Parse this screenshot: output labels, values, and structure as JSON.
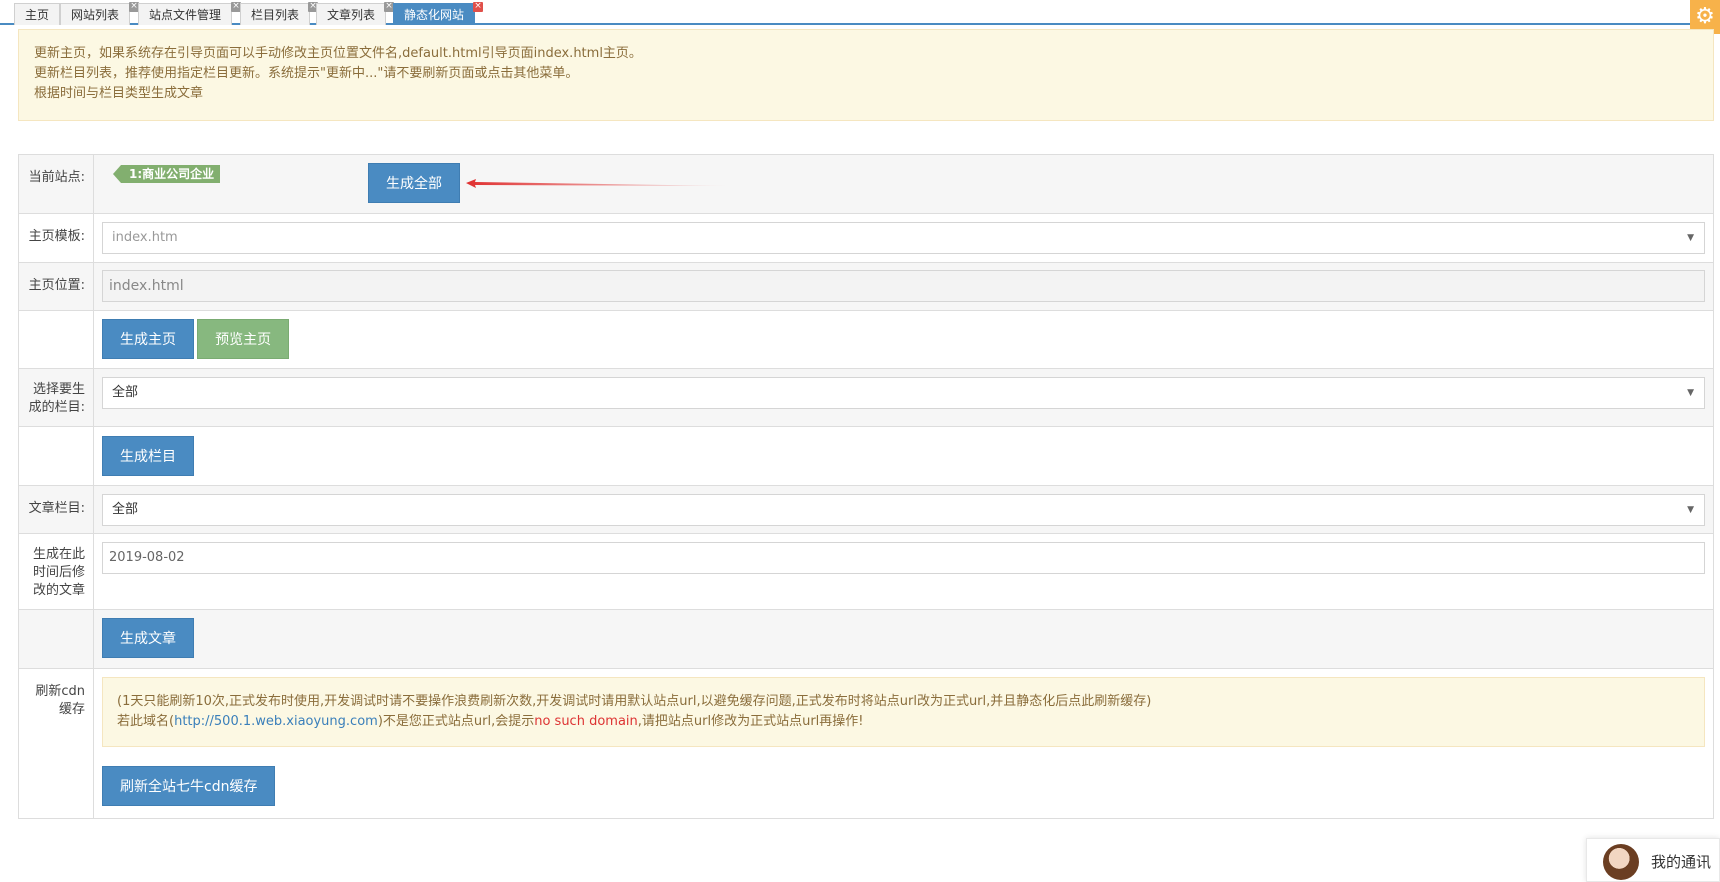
{
  "tabs": [
    {
      "label": "主页",
      "closable": false,
      "active": false
    },
    {
      "label": "网站列表",
      "closable": true,
      "active": false
    },
    {
      "label": "站点文件管理",
      "closable": true,
      "active": false
    },
    {
      "label": "栏目列表",
      "closable": true,
      "active": false
    },
    {
      "label": "文章列表",
      "closable": true,
      "active": false
    },
    {
      "label": "静态化网站",
      "closable": true,
      "active": true
    }
  ],
  "tab_close_glyph": "×",
  "settings_icon": "gear-icon",
  "notice": {
    "lines": [
      "更新主页，如果系统存在引导页面可以手动修改主页位置文件名,default.html引导页面index.html主页。",
      "更新栏目列表，推荐使用指定栏目更新。系统提示\"更新中...\"请不要刷新页面或点击其他菜单。",
      "根据时间与栏目类型生成文章"
    ]
  },
  "form": {
    "current_site": {
      "label": "当前站点:",
      "tag": "1:商业公司企业",
      "generate_all_label": "生成全部"
    },
    "home_template": {
      "label": "主页模板:",
      "value": "index.htm"
    },
    "home_location": {
      "label": "主页位置:",
      "value": "index.html"
    },
    "home_actions": {
      "generate_label": "生成主页",
      "preview_label": "预览主页"
    },
    "category_select": {
      "label": "选择要生成的栏目:",
      "value": "全部"
    },
    "category_actions": {
      "generate_label": "生成栏目"
    },
    "article_category": {
      "label": "文章栏目:",
      "value": "全部"
    },
    "modified_after": {
      "label": "生成在此时间后修改的文章",
      "value": "2019-08-02"
    },
    "article_actions": {
      "generate_label": "生成文章"
    },
    "cdn": {
      "label": "刷新cdn缓存",
      "note_line1": "(1天只能刷新10次,正式发布时使用,开发调试时请不要操作浪费刷新次数,开发调试时请用默认站点url,以避免缓存问题,正式发布时将站点url改为正式url,并且静态化后点此刷新缓存)",
      "note_prefix": "若此域名(",
      "domain": "http://500.1.web.xiaoyung.com",
      "note_middle": ")不是您正式站点url,会提示",
      "error_text": "no such domain",
      "note_suffix": ",请把站点url修改为正式站点url再操作!",
      "refresh_label": "刷新全站七牛cdn缓存"
    }
  },
  "chat_widget": {
    "label": "我的通讯"
  },
  "colors": {
    "primary": "#4a8bc2",
    "success": "#87b87f",
    "warning_bg": "#fcf8e3",
    "warning_text": "#8a6d3b",
    "arrow": "#e03030",
    "gear_bg": "#f7b24a"
  }
}
